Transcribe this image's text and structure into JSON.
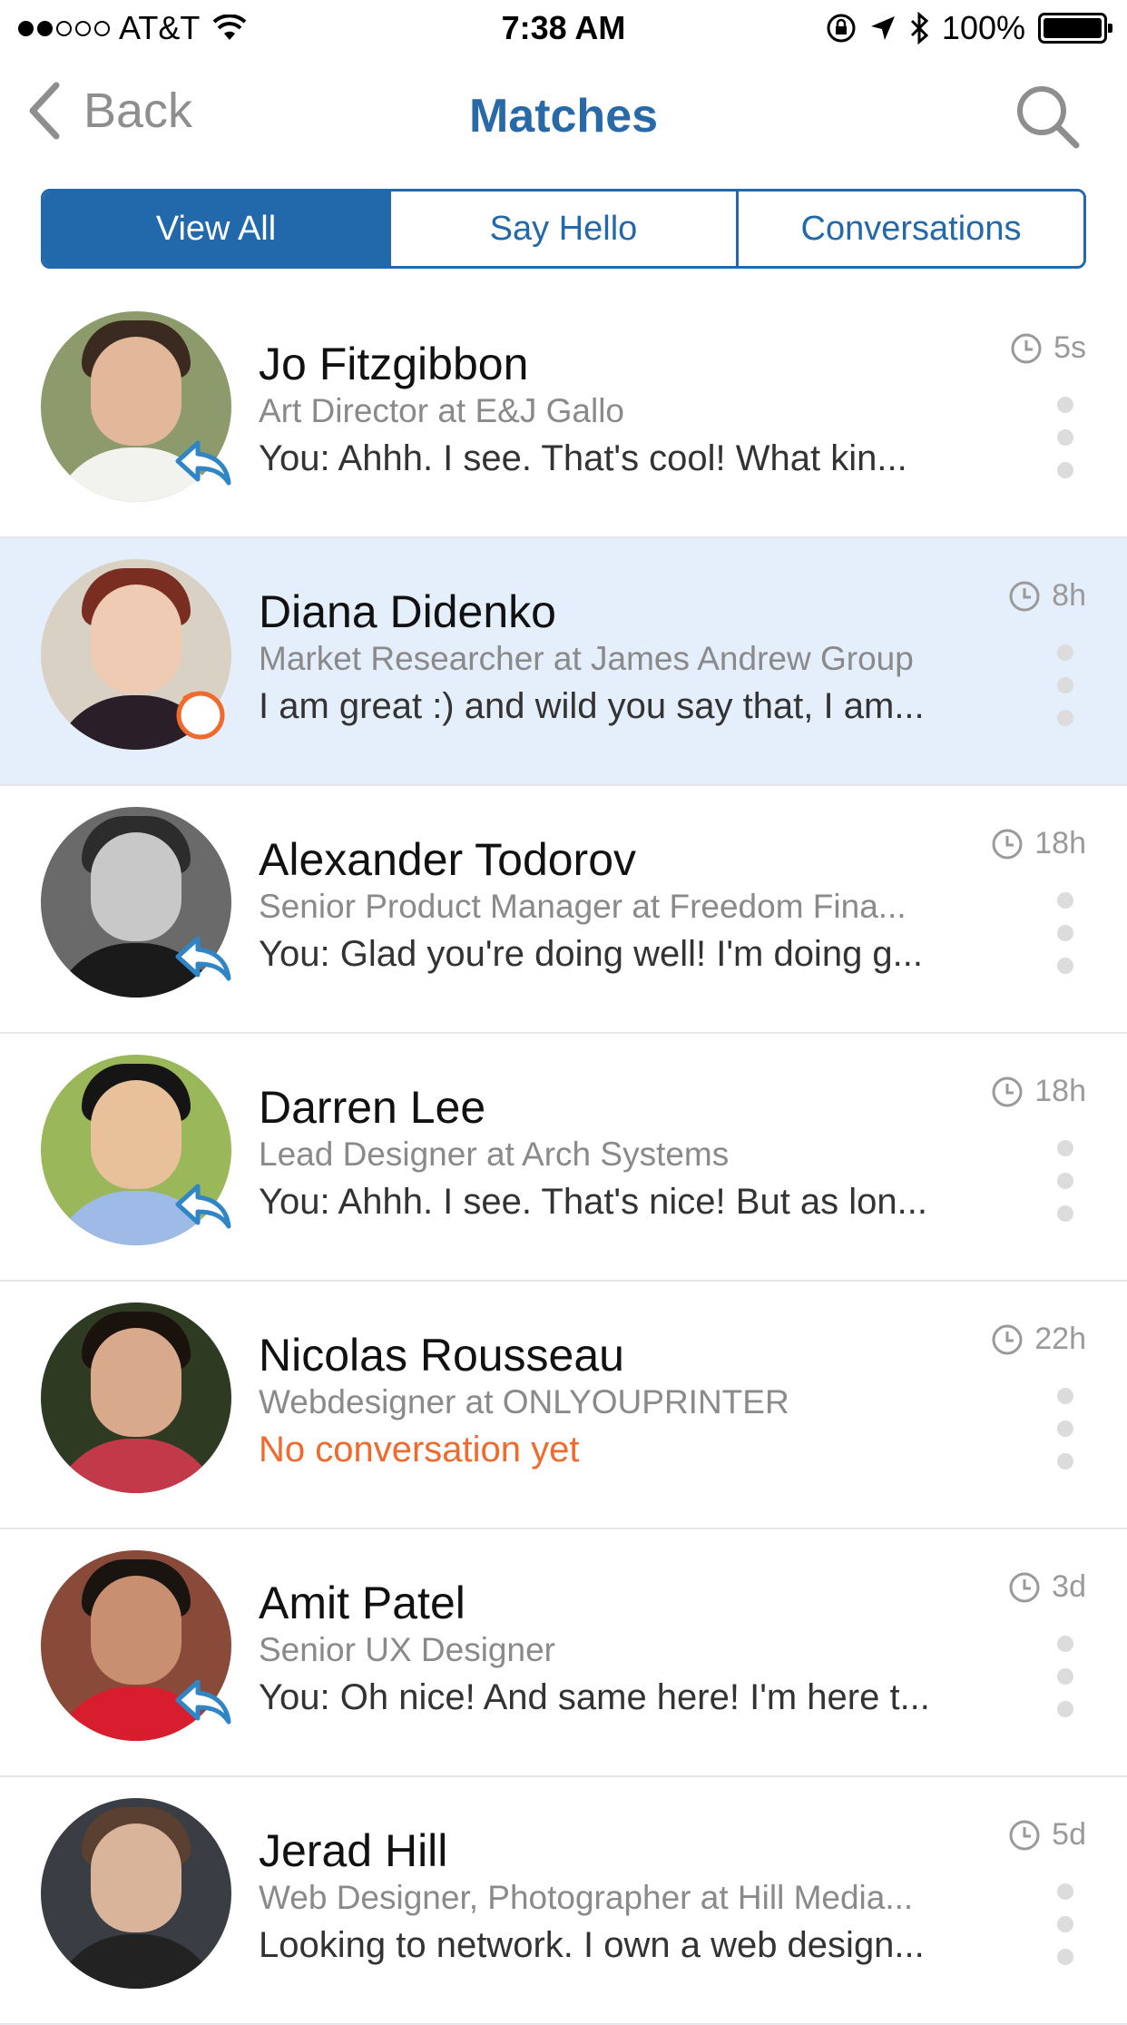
{
  "status_bar": {
    "carrier": "AT&T",
    "time": "7:38 AM",
    "battery": "100%",
    "signal_bars": 2
  },
  "nav": {
    "back_label": "Back",
    "title": "Matches",
    "title_color": "#2869a8"
  },
  "tabs": [
    {
      "label": "View All",
      "active": true
    },
    {
      "label": "Say Hello",
      "active": false
    },
    {
      "label": "Conversations",
      "active": false
    }
  ],
  "colors": {
    "accent": "#2269ac",
    "highlight_row": "#e5eefb",
    "alert": "#ef6a2c",
    "reply_icon": "#2f85c6"
  },
  "matches": [
    {
      "name": "Jo Fitzgibbon",
      "subtitle": "Art Director at E&J Gallo",
      "message": "You: Ahhh. I see. That's cool! What kin...",
      "time": "5s",
      "badge": "reply-icon"
    },
    {
      "name": "Diana Didenko",
      "subtitle": "Market Researcher at James Andrew Group",
      "message": "I am great :) and wild you say that, I am...",
      "time": "8h",
      "badge": "ring-icon",
      "highlighted": true
    },
    {
      "name": "Alexander Todorov",
      "subtitle": "Senior Product Manager at Freedom Fina...",
      "message": "You: Glad you're doing well! I'm doing g...",
      "time": "18h",
      "badge": "reply-icon"
    },
    {
      "name": "Darren Lee",
      "subtitle": "Lead Designer at Arch Systems",
      "message": "You: Ahhh. I see. That's nice! But as lon...",
      "time": "18h",
      "badge": "reply-icon"
    },
    {
      "name": "Nicolas Rousseau",
      "subtitle": "Webdesigner at ONLYOUPRINTER",
      "message": "No conversation yet",
      "time": "22h",
      "badge": "none",
      "alert": true
    },
    {
      "name": "Amit Patel",
      "subtitle": "Senior UX Designer",
      "message": "You: Oh nice! And same here! I'm here t...",
      "time": "3d",
      "badge": "reply-icon"
    },
    {
      "name": "Jerad Hill",
      "subtitle": "Web Designer, Photographer at Hill Media...",
      "message": "Looking to network. I own a web design...",
      "time": "5d",
      "badge": "none"
    }
  ]
}
